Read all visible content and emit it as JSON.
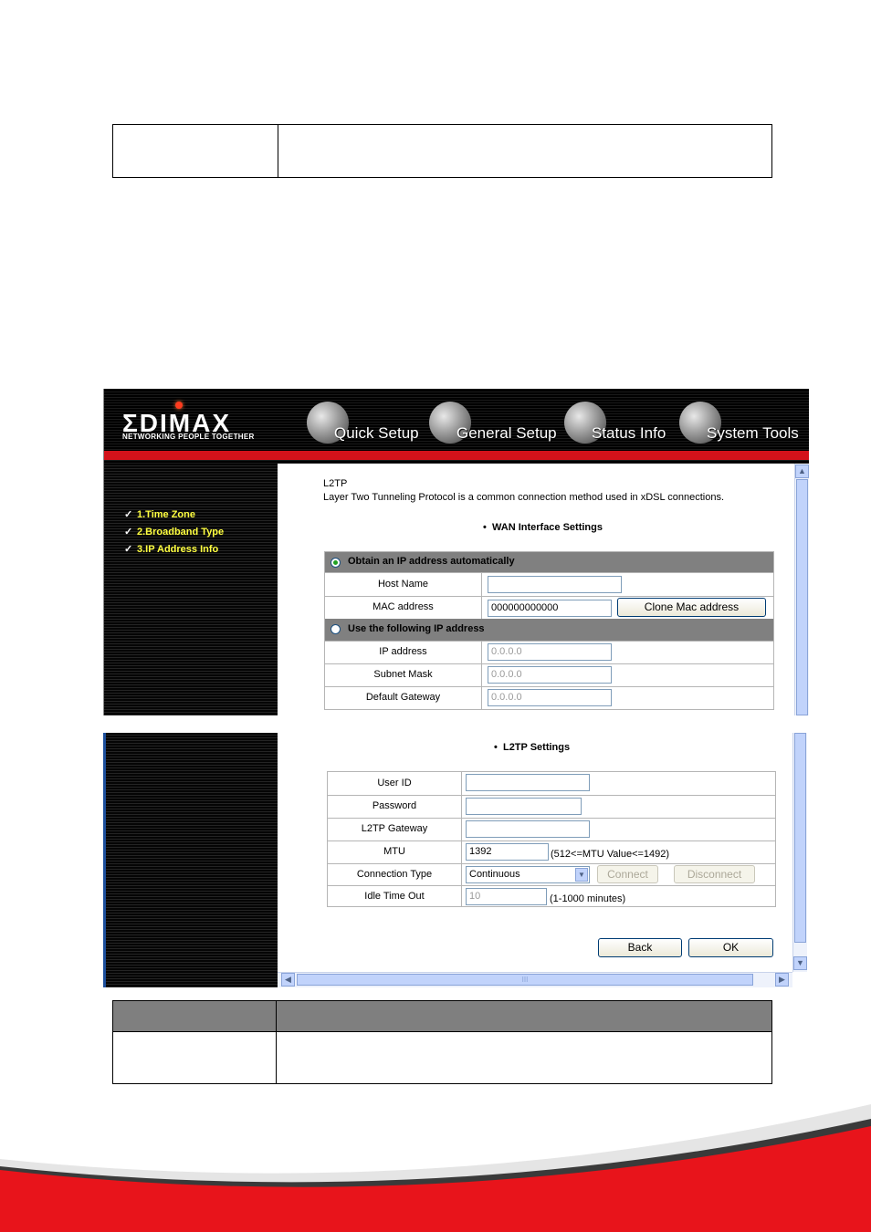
{
  "nav": {
    "brand": "ΣDIMAX",
    "tagline": "NETWORKING PEOPLE TOGETHER",
    "items": [
      {
        "label": "Quick Setup"
      },
      {
        "label": "General Setup"
      },
      {
        "label": "Status Info"
      },
      {
        "label": "System Tools"
      }
    ]
  },
  "sidebar": {
    "items": [
      {
        "label": "1.Time Zone"
      },
      {
        "label": "2.Broadband Type"
      },
      {
        "label": "3.IP Address Info"
      }
    ]
  },
  "page": {
    "title": "L2TP",
    "description": "Layer Two Tunneling Protocol is a common connection method used in xDSL connections.",
    "wan_section": "WAN Interface Settings",
    "l2tp_section": "L2TP Settings"
  },
  "wan": {
    "obtain_auto_label": "Obtain an IP address automatically",
    "obtain_auto_selected": true,
    "host_name_label": "Host Name",
    "host_name_value": "",
    "mac_label": "MAC address",
    "mac_value": "000000000000",
    "clone_mac_label": "Clone Mac address",
    "use_following_label": "Use the following IP address",
    "use_following_selected": false,
    "ip_label": "IP address",
    "ip_value": "0.0.0.0",
    "mask_label": "Subnet Mask",
    "mask_value": "0.0.0.0",
    "gateway_label": "Default Gateway",
    "gateway_value": "0.0.0.0"
  },
  "l2tp": {
    "user_id_label": "User ID",
    "user_id_value": "",
    "password_label": "Password",
    "password_value": "",
    "gateway_label": "L2TP Gateway",
    "gateway_value": "",
    "mtu_label": "MTU",
    "mtu_value": "1392",
    "mtu_hint": "(512<=MTU Value<=1492)",
    "conn_type_label": "Connection Type",
    "conn_type_value": "Continuous",
    "connect_label": "Connect",
    "disconnect_label": "Disconnect",
    "idle_label": "Idle Time Out",
    "idle_value": "10",
    "idle_hint": "(1-1000 minutes)"
  },
  "actions": {
    "back_label": "Back",
    "ok_label": "OK"
  },
  "scrollbar": {
    "grip": "III"
  },
  "colors": {
    "brand_red": "#d3121a",
    "sidebar_link": "#ffff40",
    "section_header": "#808080",
    "doc_table_header": "#7f7f7f"
  }
}
